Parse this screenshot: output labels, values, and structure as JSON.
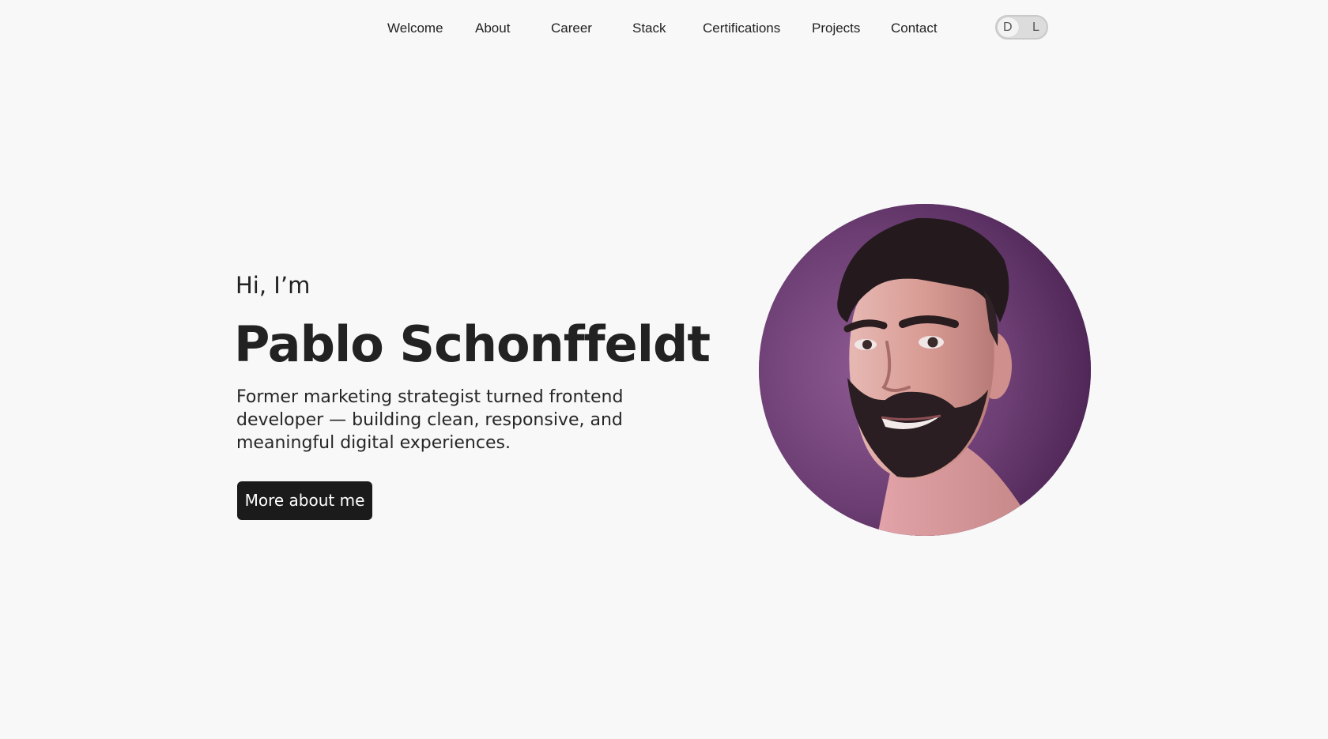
{
  "nav": {
    "items": [
      {
        "label": "Welcome"
      },
      {
        "label": "About"
      },
      {
        "label": "Career"
      },
      {
        "label": "Stack"
      },
      {
        "label": "Certifications"
      },
      {
        "label": "Projects"
      },
      {
        "label": "Contact"
      }
    ],
    "theme_toggle": {
      "dark_label": "D",
      "light_label": "L"
    }
  },
  "hero": {
    "greeting": "Hi, I’m",
    "name": "Pablo Schonffeldt",
    "tagline": "Former marketing strategist turned frontend developer — building clean, responsive, and meaningful digital experiences.",
    "button_label": "More about me"
  },
  "colors": {
    "background": "#f8f8f8",
    "text": "#222222",
    "button_bg": "#1b1b1b",
    "button_text": "#ffffff",
    "portrait_bg": "#6a3d71"
  }
}
